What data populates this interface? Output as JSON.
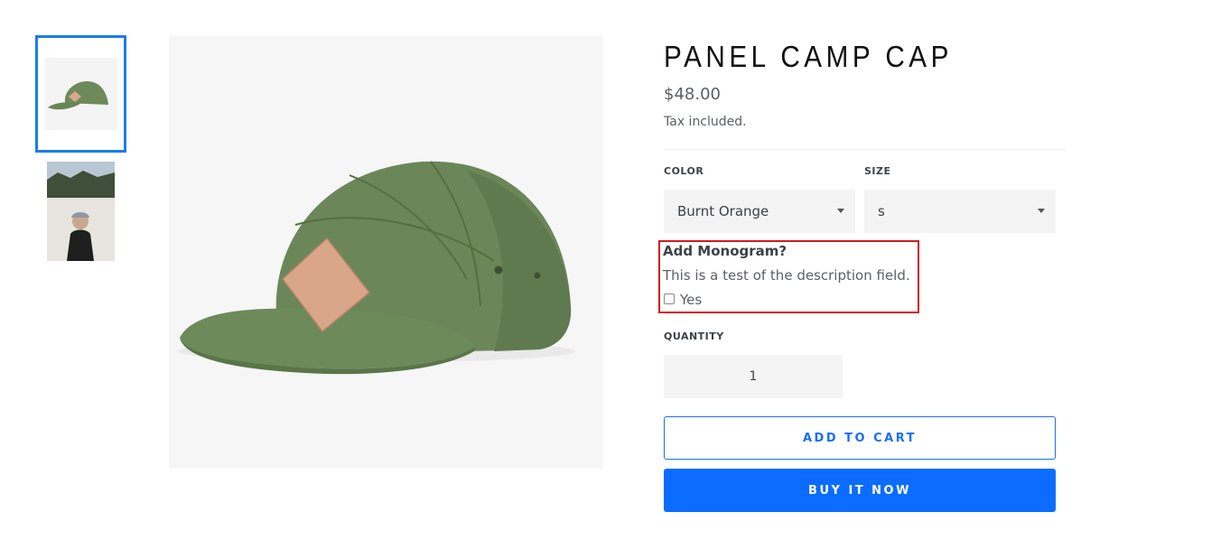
{
  "product": {
    "title": "PANEL CAMP CAP",
    "price": "$48.00",
    "tax_note": "Tax included."
  },
  "options": {
    "color": {
      "label": "COLOR",
      "selected": "Burnt Orange"
    },
    "size": {
      "label": "SIZE",
      "selected": "s"
    }
  },
  "monogram": {
    "title": "Add Monogram?",
    "description": "This is a test of the description field.",
    "checkbox_label": "Yes",
    "checked": false
  },
  "quantity": {
    "label": "QUANTITY",
    "value": "1"
  },
  "buttons": {
    "add_to_cart": "ADD TO CART",
    "buy_now": "BUY IT NOW"
  },
  "colors": {
    "accent": "#0b6cff",
    "cap_green": "#6d8a5a",
    "highlight": "#d11c1c"
  }
}
